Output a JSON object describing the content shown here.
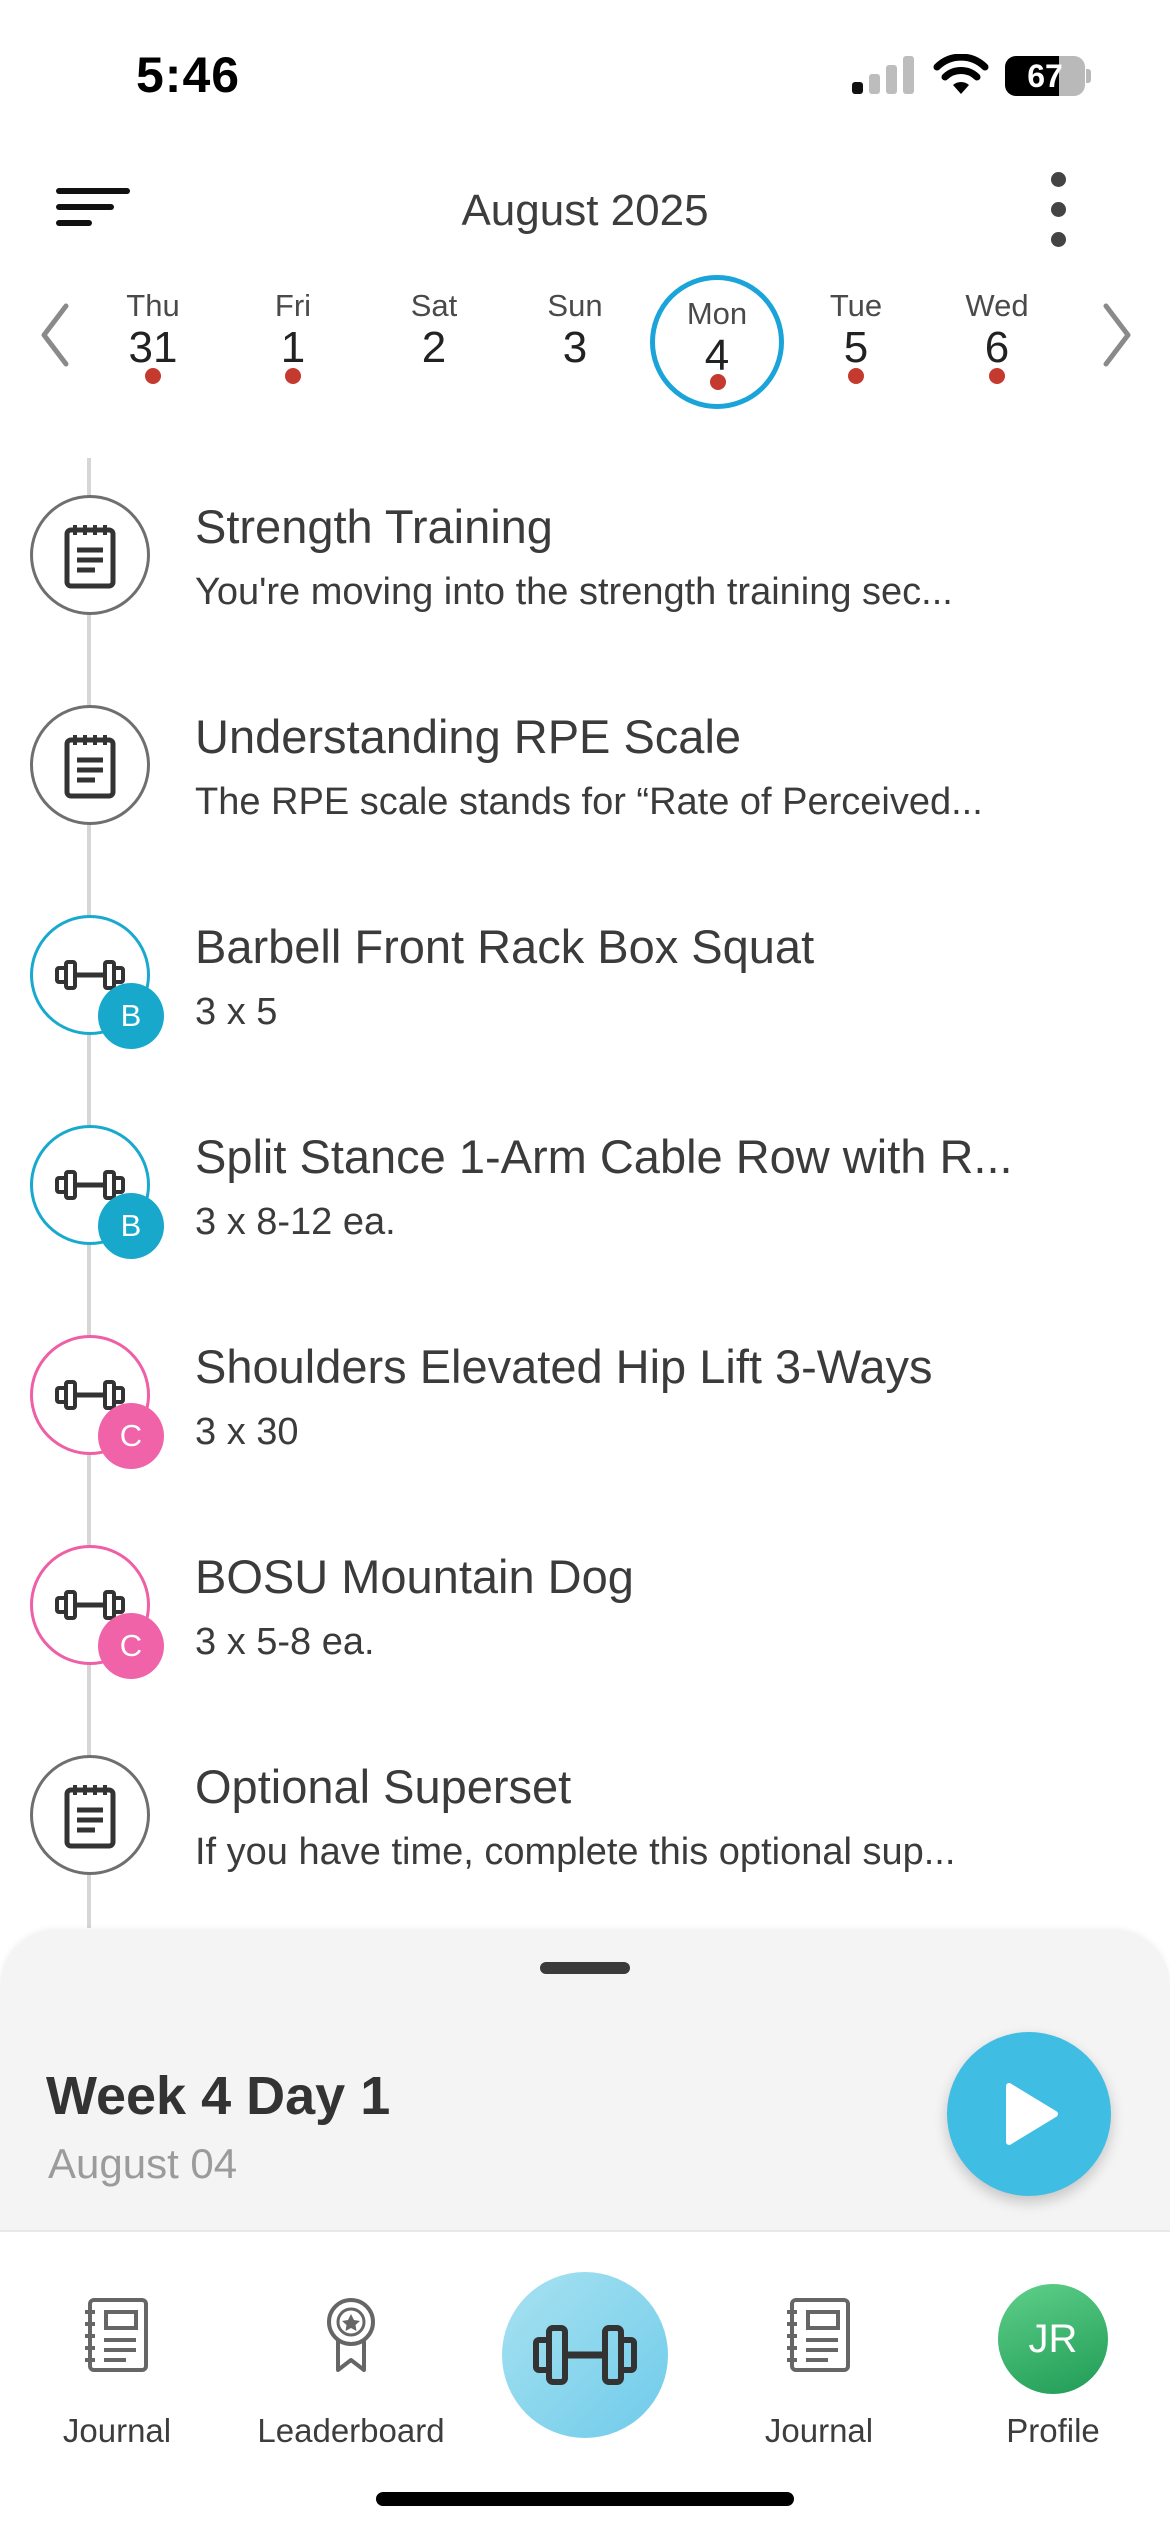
{
  "status_bar": {
    "time": "5:46",
    "battery": "67",
    "battery_level": 0.67
  },
  "header": {
    "month_title": "August 2025",
    "menu_icon": "hamburger-menu-icon",
    "more_icon": "vertical-ellipsis-icon"
  },
  "week": {
    "days": [
      {
        "name": "Thu",
        "num": "31",
        "dot": true
      },
      {
        "name": "Fri",
        "num": "1",
        "dot": true
      },
      {
        "name": "Sat",
        "num": "2",
        "dot": false
      },
      {
        "name": "Sun",
        "num": "3",
        "dot": false
      },
      {
        "name": "Mon",
        "num": "4",
        "dot": true,
        "selected": true
      },
      {
        "name": "Tue",
        "num": "5",
        "dot": true
      },
      {
        "name": "Wed",
        "num": "6",
        "dot": true
      }
    ]
  },
  "items": [
    {
      "icon": "notepad-icon",
      "badge": "",
      "title": "Strength Training",
      "subtitle": "You're moving into the strength training sec..."
    },
    {
      "icon": "notepad-icon",
      "badge": "",
      "title": "Understanding RPE Scale",
      "subtitle": "The RPE scale stands for “Rate of Perceived..."
    },
    {
      "icon": "dumbbell-icon",
      "badge": "B",
      "title": "Barbell Front Rack Box Squat",
      "subtitle": "3 x 5"
    },
    {
      "icon": "dumbbell-icon",
      "badge": "B",
      "title": "Split Stance 1-Arm Cable Row with R...",
      "subtitle": "3 x 8-12 ea."
    },
    {
      "icon": "dumbbell-icon",
      "badge": "C",
      "title": "Shoulders Elevated Hip Lift 3-Ways",
      "subtitle": "3 x 30"
    },
    {
      "icon": "dumbbell-icon",
      "badge": "C",
      "title": "BOSU Mountain Dog",
      "subtitle": "3 x 5-8 ea."
    },
    {
      "icon": "notepad-icon",
      "badge": "",
      "title": "Optional Superset",
      "subtitle": "If you have time, complete this optional sup..."
    }
  ],
  "sheet": {
    "title": "Week 4 Day 1",
    "subtitle": "August 04",
    "play_icon": "play-icon"
  },
  "tabs": [
    {
      "label": "Journal",
      "icon": "journal-icon"
    },
    {
      "label": "Leaderboard",
      "icon": "award-ribbon-icon"
    },
    {
      "label": "",
      "icon": "dumbbell-icon"
    },
    {
      "label": "Journal",
      "icon": "journal-icon"
    },
    {
      "label": "Profile",
      "avatar": "JR"
    }
  ],
  "colors": {
    "accent_blue": "#1aa4da",
    "group_b": "#17a8cc",
    "group_c": "#f163a8",
    "day_dot": "#c53a2e",
    "play_button": "#3fbde3",
    "avatar": "#2fb068"
  }
}
